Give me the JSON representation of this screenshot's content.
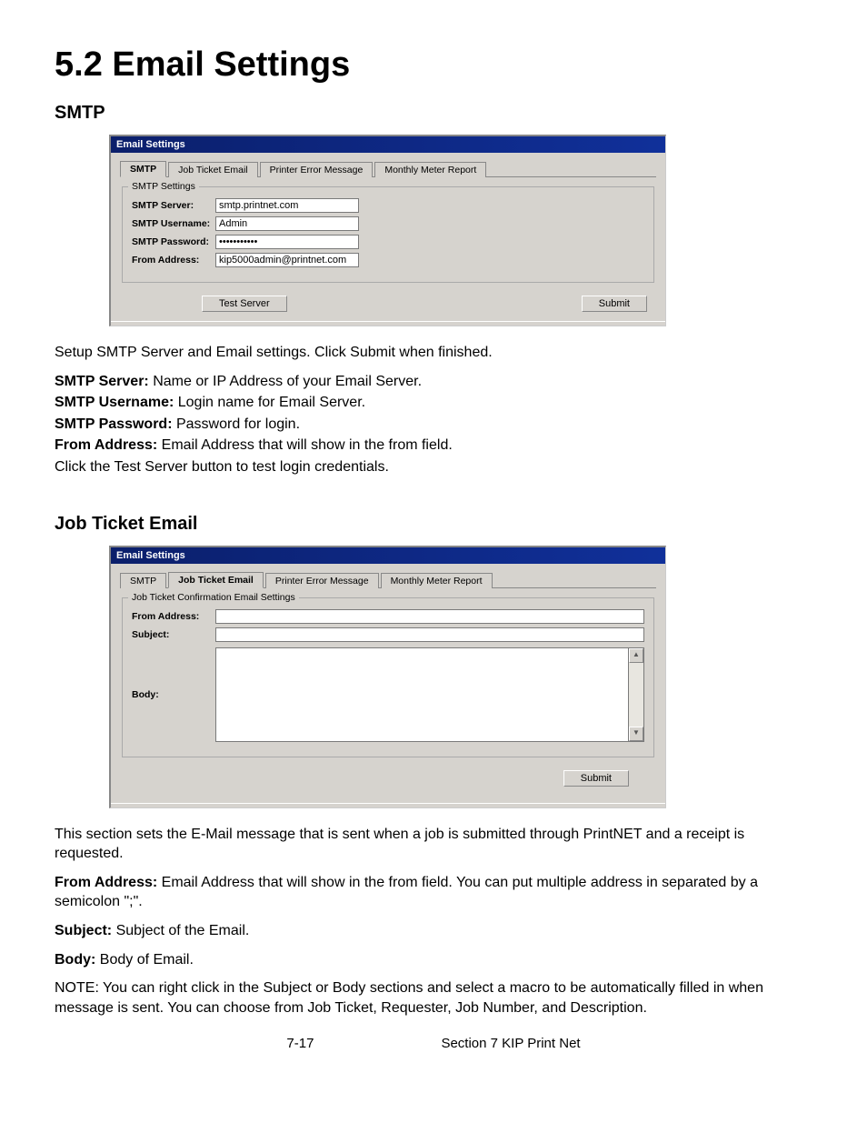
{
  "heading": "5.2 Email Settings",
  "section1": {
    "title": "SMTP",
    "window_title": "Email Settings",
    "tabs": [
      "SMTP",
      "Job Ticket Email",
      "Printer Error Message",
      "Monthly Meter Report"
    ],
    "fieldset_legend": "SMTP Settings",
    "labels": {
      "server": "SMTP Server:",
      "username": "SMTP Username:",
      "password": "SMTP Password:",
      "from": "From Address:"
    },
    "values": {
      "server": "smtp.printnet.com",
      "username": "Admin",
      "password": "•••••••••••",
      "from": "kip5000admin@printnet.com"
    },
    "buttons": {
      "test": "Test Server",
      "submit": "Submit"
    },
    "intro": "Setup SMTP Server and Email settings. Click Submit when finished.",
    "defs": {
      "server_b": "SMTP Server:",
      "server_t": " Name or IP Address of your Email Server.",
      "user_b": "SMTP Username:",
      "user_t": " Login name for Email Server.",
      "pass_b": "SMTP Password:",
      "pass_t": " Password for login.",
      "from_b": "From Address:",
      "from_t": " Email Address that will show in the from field.",
      "testline": "Click the Test Server button to test login credentials."
    }
  },
  "section2": {
    "title": "Job Ticket Email",
    "window_title": "Email Settings",
    "tabs": [
      "SMTP",
      "Job Ticket Email",
      "Printer Error Message",
      "Monthly Meter Report"
    ],
    "fieldset_legend": "Job Ticket Confirmation Email Settings",
    "labels": {
      "from": "From Address:",
      "subject": "Subject:",
      "body": "Body:"
    },
    "values": {
      "from": "",
      "subject": "",
      "body": ""
    },
    "buttons": {
      "submit": "Submit"
    },
    "intro": "This section sets the E-Mail message that is sent when a job is submitted through PrintNET and a receipt is requested.",
    "defs": {
      "from_b": "From Address:",
      "from_t": "  Email Address that will show in the from field. You can put multiple address in separated by a semicolon \";\".",
      "subj_b": "Subject:",
      "subj_t": " Subject of the Email.",
      "body_b": "Body:",
      "body_t": " Body of Email.",
      "note": "NOTE: You can right click in the Subject or Body sections and select a macro to be automatically filled in when message is sent. You can choose from Job Ticket, Requester, Job Number, and Description."
    }
  },
  "footer": {
    "page": "7-17",
    "section": "Section 7   KIP Print Net"
  }
}
